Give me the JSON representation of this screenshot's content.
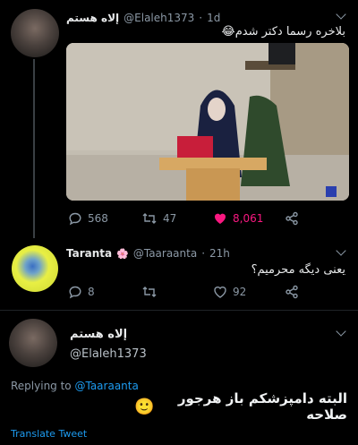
{
  "tweet1": {
    "display_name": "إلاه هستم",
    "handle": "@Elaleh1373",
    "separator": "·",
    "time": "1d",
    "text": "بلاخره رسما دکتر شدم😂",
    "stats": {
      "replies": "568",
      "retweets": "47",
      "likes": "8,061"
    },
    "like_color": "#f91880"
  },
  "tweet2": {
    "display_name": "Taranta",
    "badge": "🌸",
    "handle": "@Taaraanta",
    "separator": "·",
    "time": "21h",
    "text": "یعنی دیگه محرمیم؟",
    "stats": {
      "replies": "8",
      "retweets": "",
      "likes": "92"
    }
  },
  "tweet3": {
    "display_name": "إلاه هستم",
    "handle": "@Elaleh1373",
    "replying_prefix": "Replying to",
    "replying_handle": "@Taaraanta",
    "text": "البته دامپزشکم باز هرجور صلاحه",
    "emoji": "🙂",
    "translate_label": "Translate Tweet"
  },
  "colors": {
    "accent": "#1d9bf0",
    "background": "#000000"
  }
}
